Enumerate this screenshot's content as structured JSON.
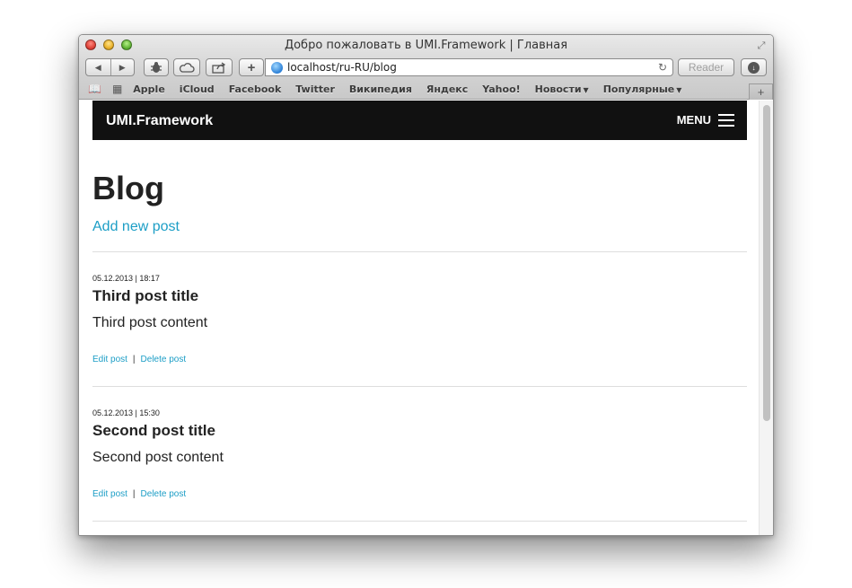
{
  "window": {
    "title": "Добро пожаловать в UMI.Framework | Главная"
  },
  "toolbar": {
    "back_icon": "◀",
    "forward_icon": "▶",
    "address": "localhost/ru-RU/blog",
    "reader_label": "Reader"
  },
  "bookmarks": {
    "items": [
      {
        "label": "Apple"
      },
      {
        "label": "iCloud"
      },
      {
        "label": "Facebook"
      },
      {
        "label": "Twitter"
      },
      {
        "label": "Википедия"
      },
      {
        "label": "Яндекс"
      },
      {
        "label": "Yahoo!"
      },
      {
        "label": "Новости",
        "dropdown": true
      },
      {
        "label": "Популярные",
        "dropdown": true
      }
    ]
  },
  "site": {
    "brand": "UMI.Framework",
    "menu_label": "MENU"
  },
  "page": {
    "title": "Blog",
    "add_link": "Add new post"
  },
  "posts": [
    {
      "meta": "05.12.2013 | 18:17",
      "title": "Third post title",
      "body": "Third post content",
      "edit_label": "Edit post",
      "separator": "|",
      "delete_label": "Delete post"
    },
    {
      "meta": "05.12.2013 | 15:30",
      "title": "Second post title",
      "body": "Second post content",
      "edit_label": "Edit post",
      "separator": "|",
      "delete_label": "Delete post"
    }
  ],
  "colors": {
    "link": "#1c9ec6",
    "navbar": "#111111"
  }
}
